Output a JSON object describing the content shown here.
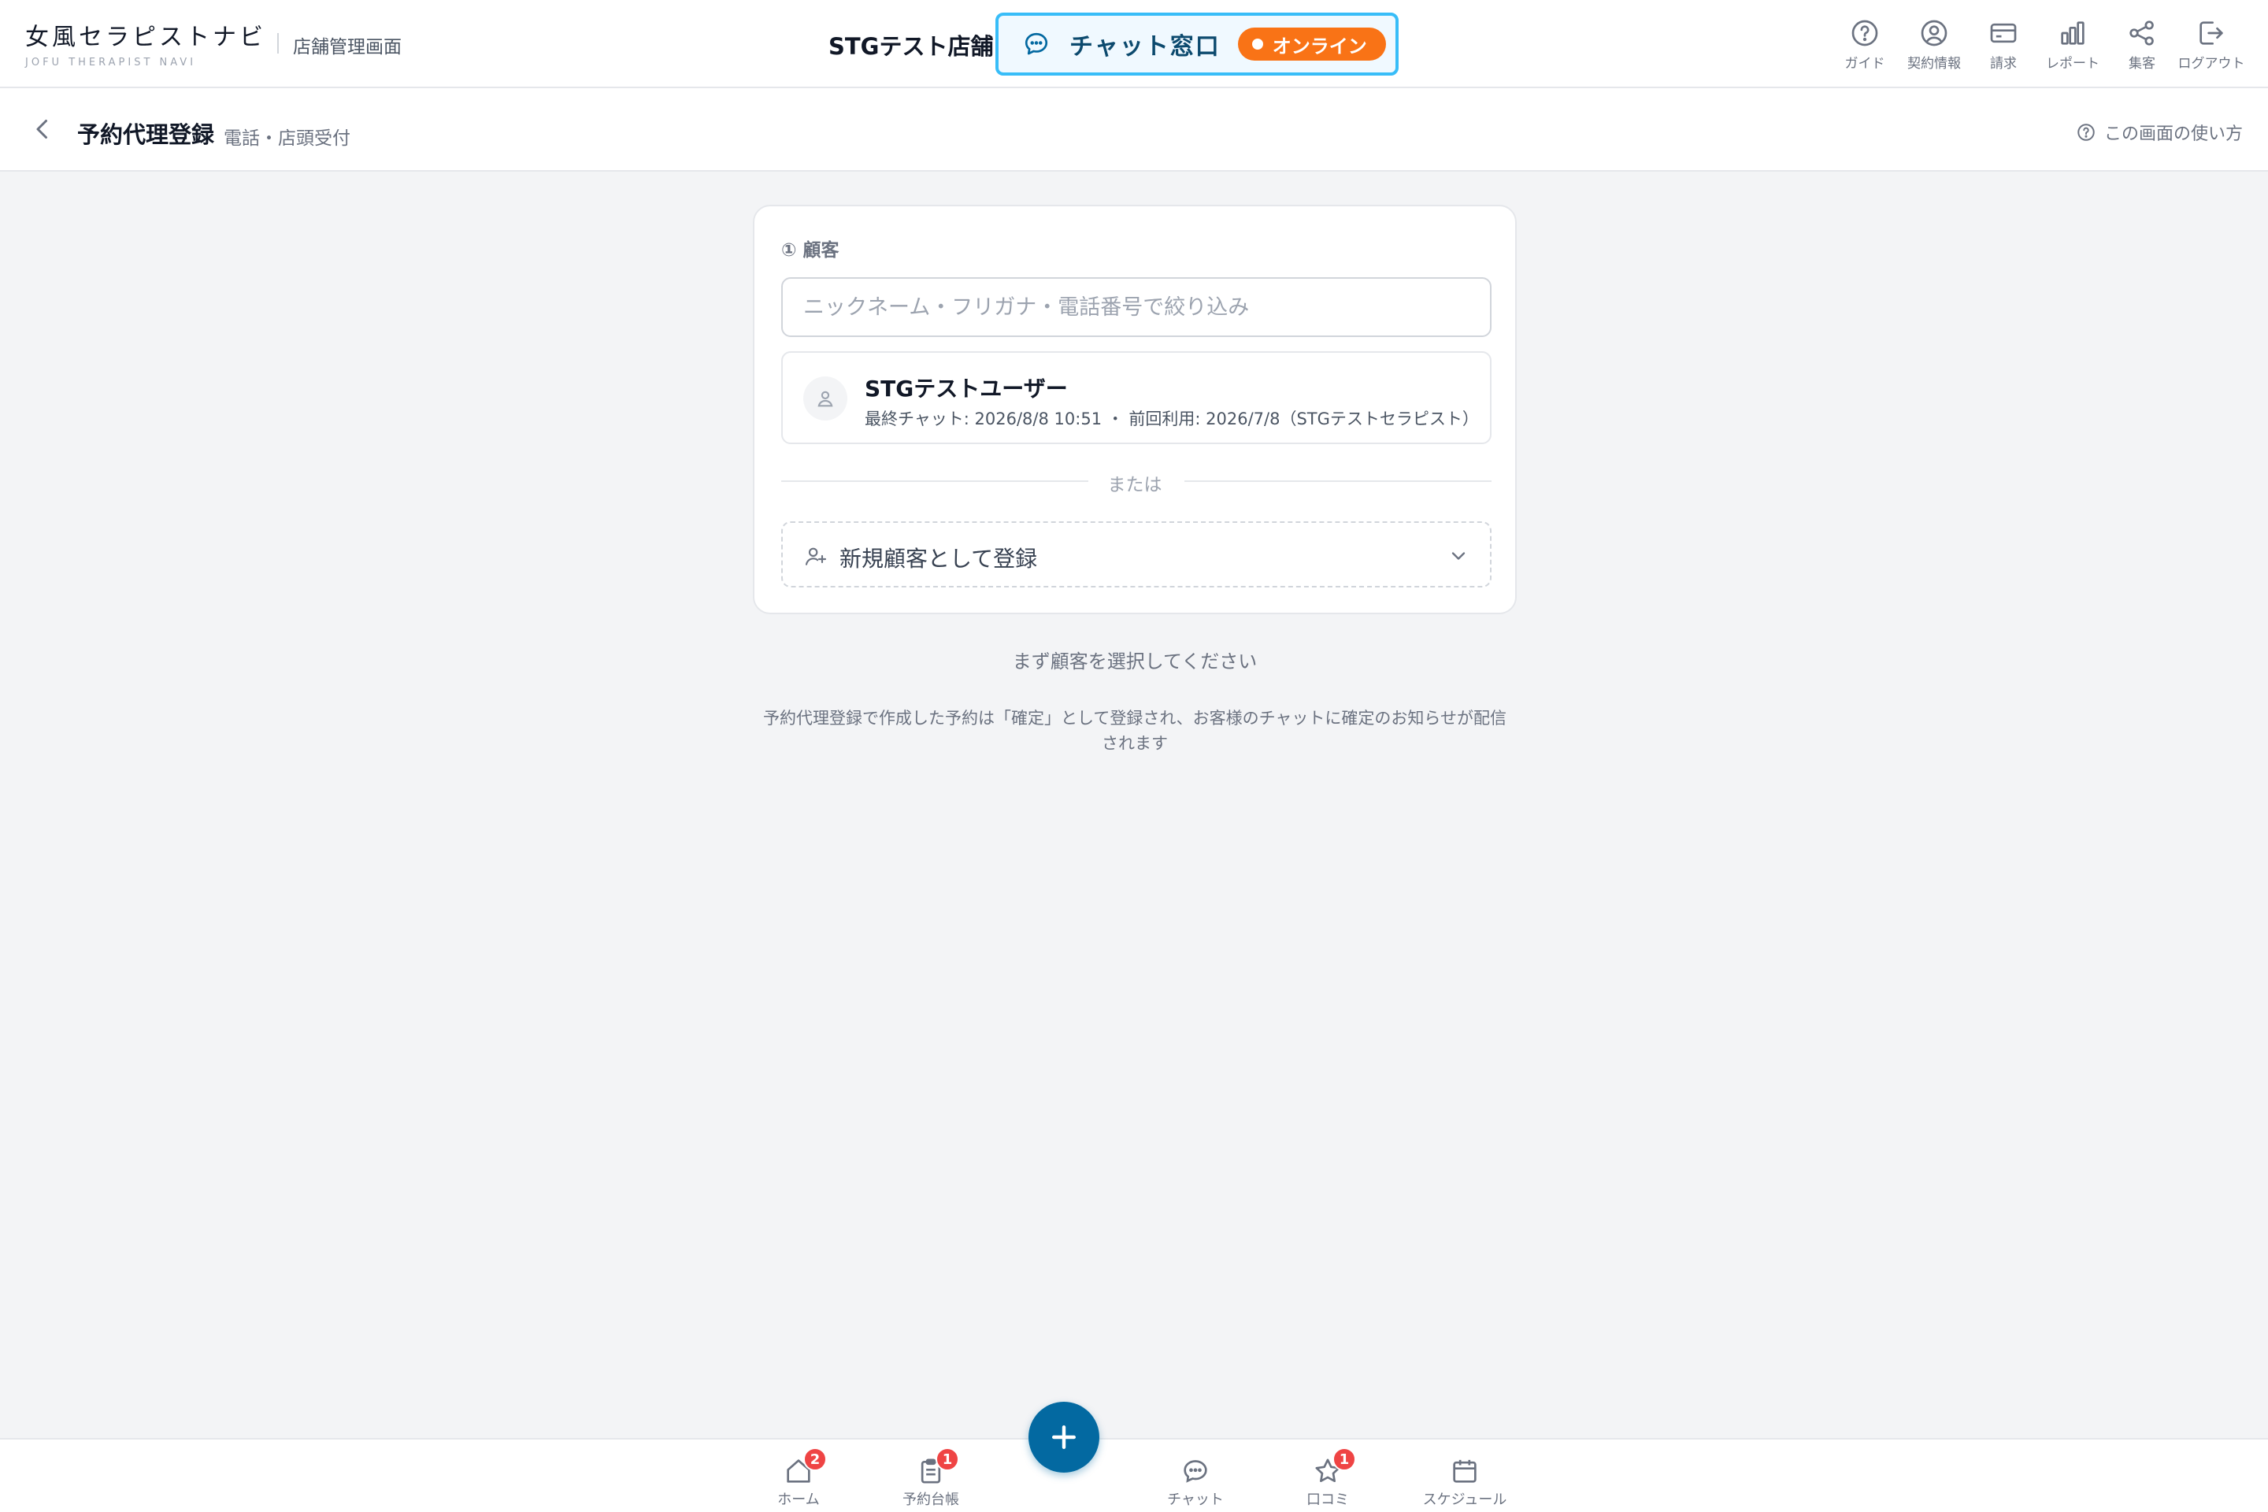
{
  "header": {
    "logo_main": "女風セラピストナビ",
    "logo_sub": "JOFU THERAPIST NAVI",
    "admin_label": "店舗管理画面",
    "store_name": "STGテスト店舗",
    "chat_window": {
      "label": "チャット窓口",
      "status": "オンライン",
      "status_color": "#f97316",
      "border_color": "#38bdf8"
    },
    "nav": [
      {
        "label": "ガイド",
        "icon": "help-circle-icon"
      },
      {
        "label": "契約情報",
        "icon": "user-circle-icon"
      },
      {
        "label": "請求",
        "icon": "credit-card-icon"
      },
      {
        "label": "レポート",
        "icon": "bar-chart-icon"
      },
      {
        "label": "集客",
        "icon": "share-icon"
      },
      {
        "label": "ログアウト",
        "icon": "logout-icon"
      }
    ]
  },
  "subheader": {
    "title": "予約代理登録",
    "subtitle": "電話・店頭受付",
    "help_label": "この画面の使い方"
  },
  "customer_section": {
    "label": "① 顧客",
    "search_placeholder": "ニックネーム・フリガナ・電話番号で絞り込み",
    "search_value": "",
    "customers": [
      {
        "name": "STGテストユーザー",
        "meta": "最終チャット: 2026/8/8 10:51 ・ 前回利用: 2026/7/8（STGテストセラピスト）"
      }
    ],
    "or_label": "または",
    "new_customer_label": "新規顧客として登録"
  },
  "select_prompt": "まず顧客を選択してください",
  "info_note": "予約代理登録で作成した予約は「確定」として登録され、お客様のチャットに確定のお知らせが配信されます",
  "bottom_nav": {
    "home": {
      "label": "ホーム",
      "badge": "2"
    },
    "ledger": {
      "label": "予約台帳",
      "badge": "1"
    },
    "chat": {
      "label": "チャット"
    },
    "reviews": {
      "label": "口コミ",
      "badge": "1"
    },
    "schedule": {
      "label": "スケジュール"
    },
    "fab_icon": "plus-icon",
    "accent_color": "#0369a1",
    "badge_color": "#ef4444"
  }
}
